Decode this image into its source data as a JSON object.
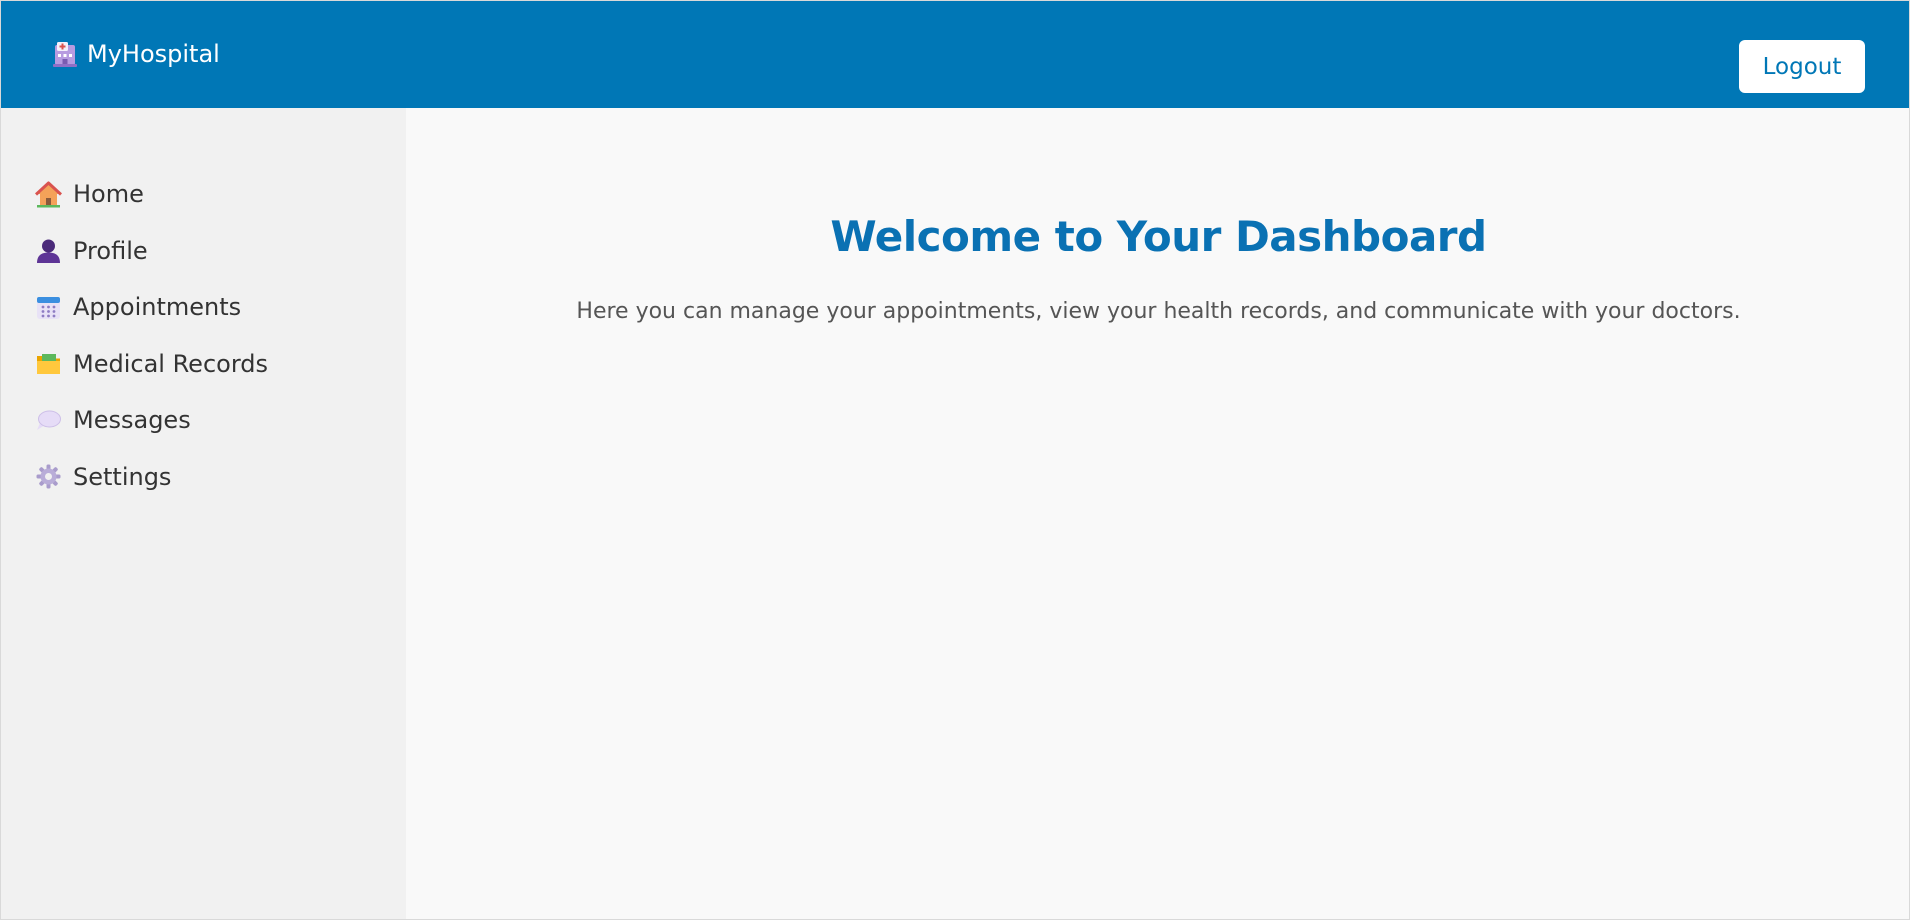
{
  "header": {
    "brand": "MyHospital",
    "brand_icon": "hospital-icon",
    "logout_label": "Logout"
  },
  "sidebar": {
    "items": [
      {
        "label": "Home",
        "icon": "house-icon"
      },
      {
        "label": "Profile",
        "icon": "person-icon"
      },
      {
        "label": "Appointments",
        "icon": "calendar-icon"
      },
      {
        "label": "Medical Records",
        "icon": "folder-icon"
      },
      {
        "label": "Messages",
        "icon": "speech-bubble-icon"
      },
      {
        "label": "Settings",
        "icon": "gear-icon"
      }
    ]
  },
  "main": {
    "title": "Welcome to Your Dashboard",
    "subtitle": "Here you can manage your appointments, view your health records, and communicate with your doctors."
  },
  "colors": {
    "header_bg": "#0077b6",
    "sidebar_bg": "#f1f1f1",
    "main_bg": "#f9f9f9",
    "title": "#0a71b3"
  }
}
